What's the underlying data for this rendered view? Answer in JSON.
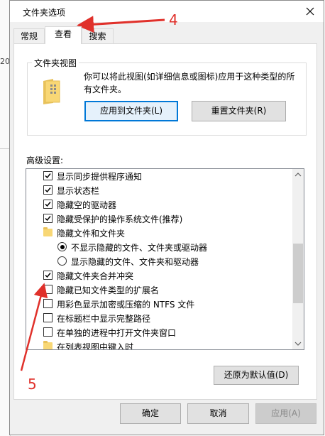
{
  "dialog": {
    "title": "文件夹选项",
    "close_icon": "close-icon"
  },
  "tabs": [
    {
      "label": "常规",
      "active": false
    },
    {
      "label": "查看",
      "active": true
    },
    {
      "label": "搜索",
      "active": false
    }
  ],
  "folder_view": {
    "group_label": "文件夹视图",
    "description": "你可以将此视图(如详细信息或图标)应用于这种类型的所有文件夹。",
    "apply_button": "应用到文件夹(L)",
    "reset_button": "重置文件夹(R)",
    "icon": "folder-grid-icon"
  },
  "advanced": {
    "label": "高级设置:",
    "items": [
      {
        "type": "checkbox",
        "label": "显示同步提供程序通知",
        "checked": true
      },
      {
        "type": "checkbox",
        "label": "显示状态栏",
        "checked": true
      },
      {
        "type": "checkbox",
        "label": "隐藏空的驱动器",
        "checked": true
      },
      {
        "type": "checkbox",
        "label": "隐藏受保护的操作系统文件(推荐)",
        "checked": true
      },
      {
        "type": "folder",
        "label": "隐藏文件和文件夹"
      },
      {
        "type": "radio",
        "label": "不显示隐藏的文件、文件夹或驱动器",
        "checked": true
      },
      {
        "type": "radio",
        "label": "显示隐藏的文件、文件夹和驱动器",
        "checked": false
      },
      {
        "type": "checkbox",
        "label": "隐藏文件夹合并冲突",
        "checked": true
      },
      {
        "type": "checkbox",
        "label": "隐藏已知文件类型的扩展名",
        "checked": false
      },
      {
        "type": "checkbox",
        "label": "用彩色显示加密或压缩的 NTFS 文件",
        "checked": false
      },
      {
        "type": "checkbox",
        "label": "在标题栏中显示完整路径",
        "checked": false
      },
      {
        "type": "checkbox",
        "label": "在单独的进程中打开文件夹窗口",
        "checked": false
      },
      {
        "type": "folder",
        "label": "在列表视图中键入时"
      }
    ]
  },
  "restore_button": "还原为默认值(D)",
  "footer": {
    "ok": "确定",
    "cancel": "取消",
    "apply": "应用(A)"
  },
  "annotations": {
    "step_tab": "4",
    "step_checkbox": "5",
    "color": "#e0312b"
  },
  "background": {
    "partial_text": "20"
  }
}
